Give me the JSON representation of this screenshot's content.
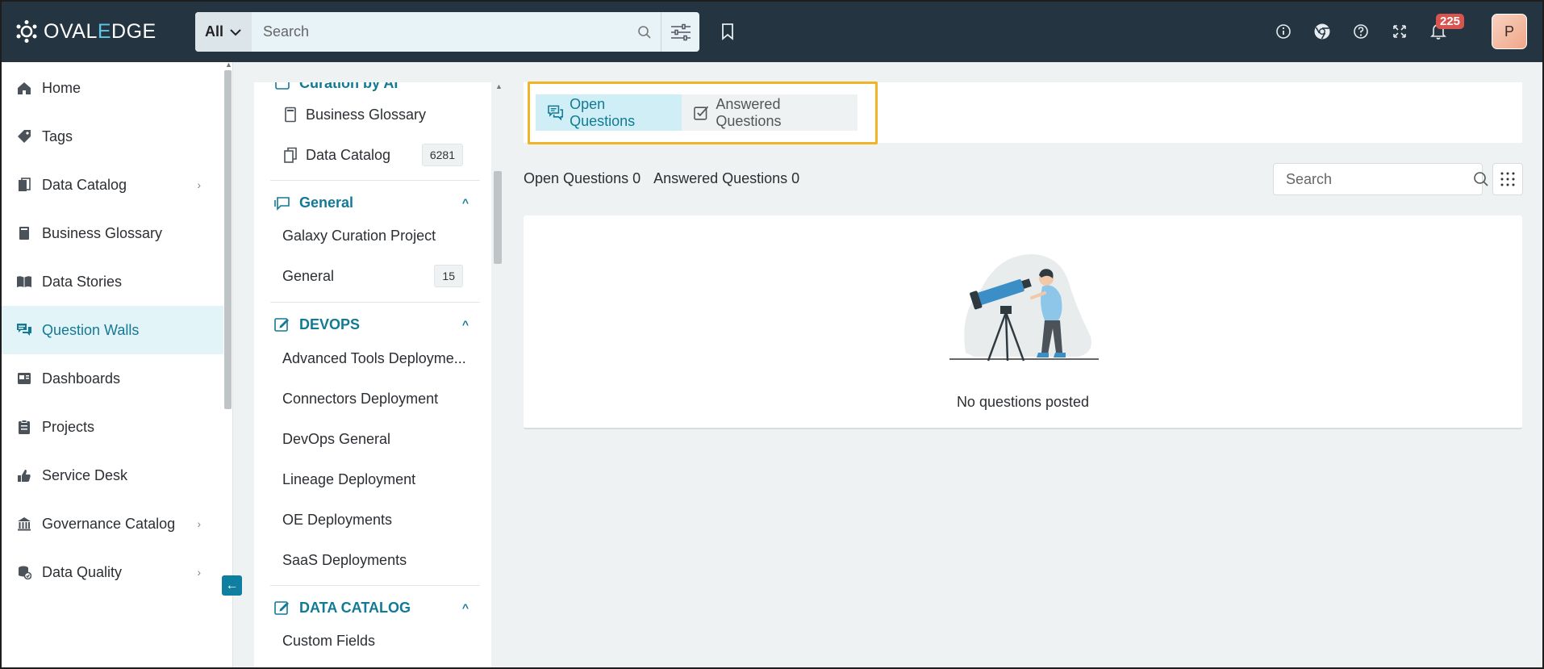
{
  "app": {
    "logo_text_a": "OVAL",
    "logo_text_e": "E",
    "logo_text_b": "DGE"
  },
  "topbar": {
    "search_scope": "All",
    "search_placeholder": "Search",
    "notification_count": "225",
    "avatar_initial": "P",
    "icons": [
      "info-icon",
      "chrome-icon",
      "help-icon",
      "fullscreen-icon",
      "bell-icon"
    ]
  },
  "sidebar": {
    "items": [
      {
        "label": "Home",
        "icon": "home-icon"
      },
      {
        "label": "Tags",
        "icon": "tag-icon"
      },
      {
        "label": "Data Catalog",
        "icon": "catalog-icon",
        "chevron": true
      },
      {
        "label": "Business Glossary",
        "icon": "book-icon"
      },
      {
        "label": "Data Stories",
        "icon": "stories-icon"
      },
      {
        "label": "Question Walls",
        "icon": "chat-icon",
        "active": true
      },
      {
        "label": "Dashboards",
        "icon": "dashboard-icon"
      },
      {
        "label": "Projects",
        "icon": "clipboard-icon"
      },
      {
        "label": "Service Desk",
        "icon": "hand-icon"
      },
      {
        "label": "Governance Catalog",
        "icon": "bank-icon",
        "chevron": true
      },
      {
        "label": "Data Quality",
        "icon": "quality-icon",
        "chevron": true
      }
    ]
  },
  "walls": {
    "cut_heading": "Curation by AI",
    "top_items": [
      {
        "label": "Business Glossary"
      },
      {
        "label": "Data Catalog",
        "count": "6281"
      }
    ],
    "general": {
      "heading": "General",
      "items": [
        {
          "label": "Galaxy Curation Project"
        },
        {
          "label": "General",
          "count": "15"
        }
      ]
    },
    "devops": {
      "heading": "DEVOPS",
      "items": [
        {
          "label": "Advanced Tools Deployme..."
        },
        {
          "label": "Connectors Deployment"
        },
        {
          "label": "DevOps General"
        },
        {
          "label": "Lineage Deployment"
        },
        {
          "label": "OE Deployments"
        },
        {
          "label": "SaaS Deployments"
        }
      ]
    },
    "data_catalog": {
      "heading": "DATA CATALOG",
      "items": [
        {
          "label": "Custom Fields"
        }
      ]
    }
  },
  "main": {
    "tabs": [
      {
        "label": "Open Questions",
        "active": true
      },
      {
        "label": "Answered Questions"
      }
    ],
    "open_count_label": "Open Questions 0",
    "answered_count_label": "Answered Questions 0",
    "search_placeholder": "Search",
    "empty_text": "No questions posted"
  },
  "colors": {
    "topbar": "#243541",
    "accent": "#127a95",
    "highlight_border": "#f0b428",
    "badge": "#d9534f"
  }
}
